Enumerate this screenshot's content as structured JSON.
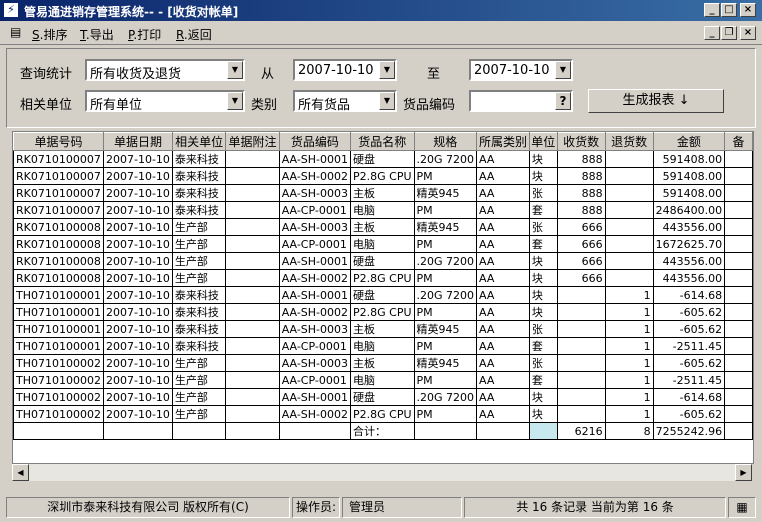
{
  "window": {
    "title": "管易通进销存管理系统--  - [收货对帐单]"
  },
  "menu": {
    "items": [
      {
        "key": "S",
        "label": ".排序"
      },
      {
        "key": "T",
        "label": ".导出"
      },
      {
        "key": "P",
        "label": ".打印"
      },
      {
        "key": "R",
        "label": ".返回"
      }
    ]
  },
  "filters": {
    "query_label": "查询统计",
    "query_value": "所有收货及退货",
    "from_label": "从",
    "from_date": "2007-10-10",
    "to_label": "至",
    "to_date": "2007-10-10",
    "unit_label": "相关单位",
    "unit_value": "所有单位",
    "category_label": "类别",
    "category_value": "所有货品",
    "code_label": "货品编码",
    "code_value": "",
    "code_btn": "?",
    "generate_btn": "生成报表 ↓"
  },
  "table": {
    "columns": [
      "单据号码",
      "单据日期",
      "相关单位",
      "单据附注",
      "货品编码",
      "货品名称",
      "规格",
      "所属类别",
      "单位",
      "收货数",
      "退货数",
      "金额",
      "备"
    ],
    "rows": [
      [
        "RK0710100007",
        "2007-10-10",
        "泰来科技",
        "",
        "AA-SH-0001",
        "硬盘",
        ".20G 7200",
        "AA",
        "块",
        "888",
        "",
        "591408.00",
        ""
      ],
      [
        "RK0710100007",
        "2007-10-10",
        "泰来科技",
        "",
        "AA-SH-0002",
        "P2.8G CPU",
        "PM",
        "AA",
        "块",
        "888",
        "",
        "591408.00",
        ""
      ],
      [
        "RK0710100007",
        "2007-10-10",
        "泰来科技",
        "",
        "AA-SH-0003",
        "主板",
        "精英945",
        "AA",
        "张",
        "888",
        "",
        "591408.00",
        ""
      ],
      [
        "RK0710100007",
        "2007-10-10",
        "泰来科技",
        "",
        "AA-CP-0001",
        "电脑",
        "PM",
        "AA",
        "套",
        "888",
        "",
        "2486400.00",
        ""
      ],
      [
        "RK0710100008",
        "2007-10-10",
        "生产部",
        "",
        "AA-SH-0003",
        "主板",
        "精英945",
        "AA",
        "张",
        "666",
        "",
        "443556.00",
        ""
      ],
      [
        "RK0710100008",
        "2007-10-10",
        "生产部",
        "",
        "AA-CP-0001",
        "电脑",
        "PM",
        "AA",
        "套",
        "666",
        "",
        "1672625.70",
        ""
      ],
      [
        "RK0710100008",
        "2007-10-10",
        "生产部",
        "",
        "AA-SH-0001",
        "硬盘",
        ".20G 7200",
        "AA",
        "块",
        "666",
        "",
        "443556.00",
        ""
      ],
      [
        "RK0710100008",
        "2007-10-10",
        "生产部",
        "",
        "AA-SH-0002",
        "P2.8G CPU",
        "PM",
        "AA",
        "块",
        "666",
        "",
        "443556.00",
        ""
      ],
      [
        "TH0710100001",
        "2007-10-10",
        "泰来科技",
        "",
        "AA-SH-0001",
        "硬盘",
        ".20G 7200",
        "AA",
        "块",
        "",
        "1",
        "-614.68",
        ""
      ],
      [
        "TH0710100001",
        "2007-10-10",
        "泰来科技",
        "",
        "AA-SH-0002",
        "P2.8G CPU",
        "PM",
        "AA",
        "块",
        "",
        "1",
        "-605.62",
        ""
      ],
      [
        "TH0710100001",
        "2007-10-10",
        "泰来科技",
        "",
        "AA-SH-0003",
        "主板",
        "精英945",
        "AA",
        "张",
        "",
        "1",
        "-605.62",
        ""
      ],
      [
        "TH0710100001",
        "2007-10-10",
        "泰来科技",
        "",
        "AA-CP-0001",
        "电脑",
        "PM",
        "AA",
        "套",
        "",
        "1",
        "-2511.45",
        ""
      ],
      [
        "TH0710100002",
        "2007-10-10",
        "生产部",
        "",
        "AA-SH-0003",
        "主板",
        "精英945",
        "AA",
        "张",
        "",
        "1",
        "-605.62",
        ""
      ],
      [
        "TH0710100002",
        "2007-10-10",
        "生产部",
        "",
        "AA-CP-0001",
        "电脑",
        "PM",
        "AA",
        "套",
        "",
        "1",
        "-2511.45",
        ""
      ],
      [
        "TH0710100002",
        "2007-10-10",
        "生产部",
        "",
        "AA-SH-0001",
        "硬盘",
        ".20G 7200",
        "AA",
        "块",
        "",
        "1",
        "-614.68",
        ""
      ],
      [
        "TH0710100002",
        "2007-10-10",
        "生产部",
        "",
        "AA-SH-0002",
        "P2.8G CPU",
        "PM",
        "AA",
        "块",
        "",
        "1",
        "-605.62",
        ""
      ]
    ],
    "total_row": [
      "",
      "",
      "",
      "",
      "",
      "合计：",
      "",
      "",
      "",
      "6216",
      "8",
      "7255242.96",
      ""
    ]
  },
  "status": {
    "company": "深圳市泰来科技有限公司 版权所有(C)",
    "operator_label": "操作员:",
    "operator": "管理员",
    "records": "共 16 条记录 当前为第 16 条"
  }
}
